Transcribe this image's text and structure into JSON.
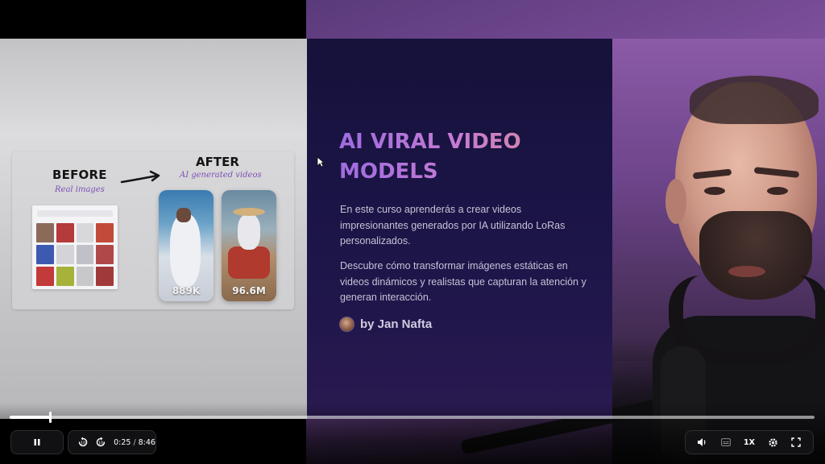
{
  "slide": {
    "before_label": "BEFORE",
    "before_sub": "Real images",
    "after_label": "AFTER",
    "after_sub": "AI generated videos",
    "video1_count": "889K",
    "video2_count": "96.6M",
    "title": "AI VIRAL VIDEO MODELS",
    "paragraph1": "En este curso aprenderás a crear videos impresionantes generados por IA utilizando LoRas personalizados.",
    "paragraph2": "Descubre cómo transformar imágenes estáticas en videos dinámicos y realistas que capturan la atención y generan interacción.",
    "author": "by Jan Nafta"
  },
  "player": {
    "progress": 0.05,
    "current_time": "0:25",
    "duration": "8:46",
    "speed": "1X",
    "icons": {
      "pause": "pause-icon",
      "rewind": "rewind-10-icon",
      "forward": "forward-10-icon",
      "volume": "volume-icon",
      "captions": "captions-icon",
      "settings": "settings-gear-icon",
      "fullscreen": "fullscreen-icon"
    }
  },
  "colors": {
    "slide_bg": "#1a1445",
    "title_gradient_start": "#9e6ce0",
    "title_gradient_end": "#e08e8a",
    "accent_purple": "#7b50b5",
    "webcam_bg": "#7d4f9c"
  }
}
